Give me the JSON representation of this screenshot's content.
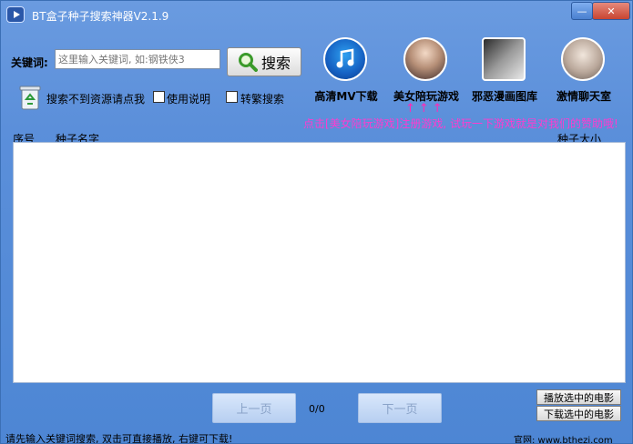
{
  "window": {
    "title": "BT盒子种子搜索神器V2.1.9"
  },
  "titlebar": {
    "min_label": "—",
    "close_label": "✕"
  },
  "search": {
    "label": "关键词:",
    "placeholder": "这里输入关键词, 如:钢铁侠3",
    "button_label": "搜索"
  },
  "options": {
    "not_found_label": "搜索不到资源请点我",
    "usage_label": "使用说明",
    "convert_label": "转繁搜索"
  },
  "promos": [
    {
      "label": "高清MV下载",
      "icon": "music-note-icon"
    },
    {
      "label": "美女陪玩游戏",
      "icon": "game-avatar-image"
    },
    {
      "label": "邪恶漫画图库",
      "icon": "comic-image"
    },
    {
      "label": "激情聊天室",
      "icon": "chat-avatar-image"
    }
  ],
  "promo_arrows": "↑↑↑",
  "promo_note": "点击[美女陪玩游戏]注册游戏, 试玩一下游戏就是对我们的赞助哦!",
  "table": {
    "columns": [
      "序号",
      "种子名字",
      "种子大小"
    ],
    "rows": []
  },
  "pagination": {
    "prev_label": "上一页",
    "next_label": "下一页",
    "page_info": "0/0"
  },
  "actions": {
    "play_label": "播放选中的电影",
    "download_label": "下载选中的电影"
  },
  "statusbar": {
    "text": "请先输入关键词搜索, 双击可直接播放, 右键可下载!",
    "site": "官网: www.bthezi.com"
  },
  "colors": {
    "window_bg": "#5b8fda",
    "promo_text": "#ff3bd0"
  }
}
